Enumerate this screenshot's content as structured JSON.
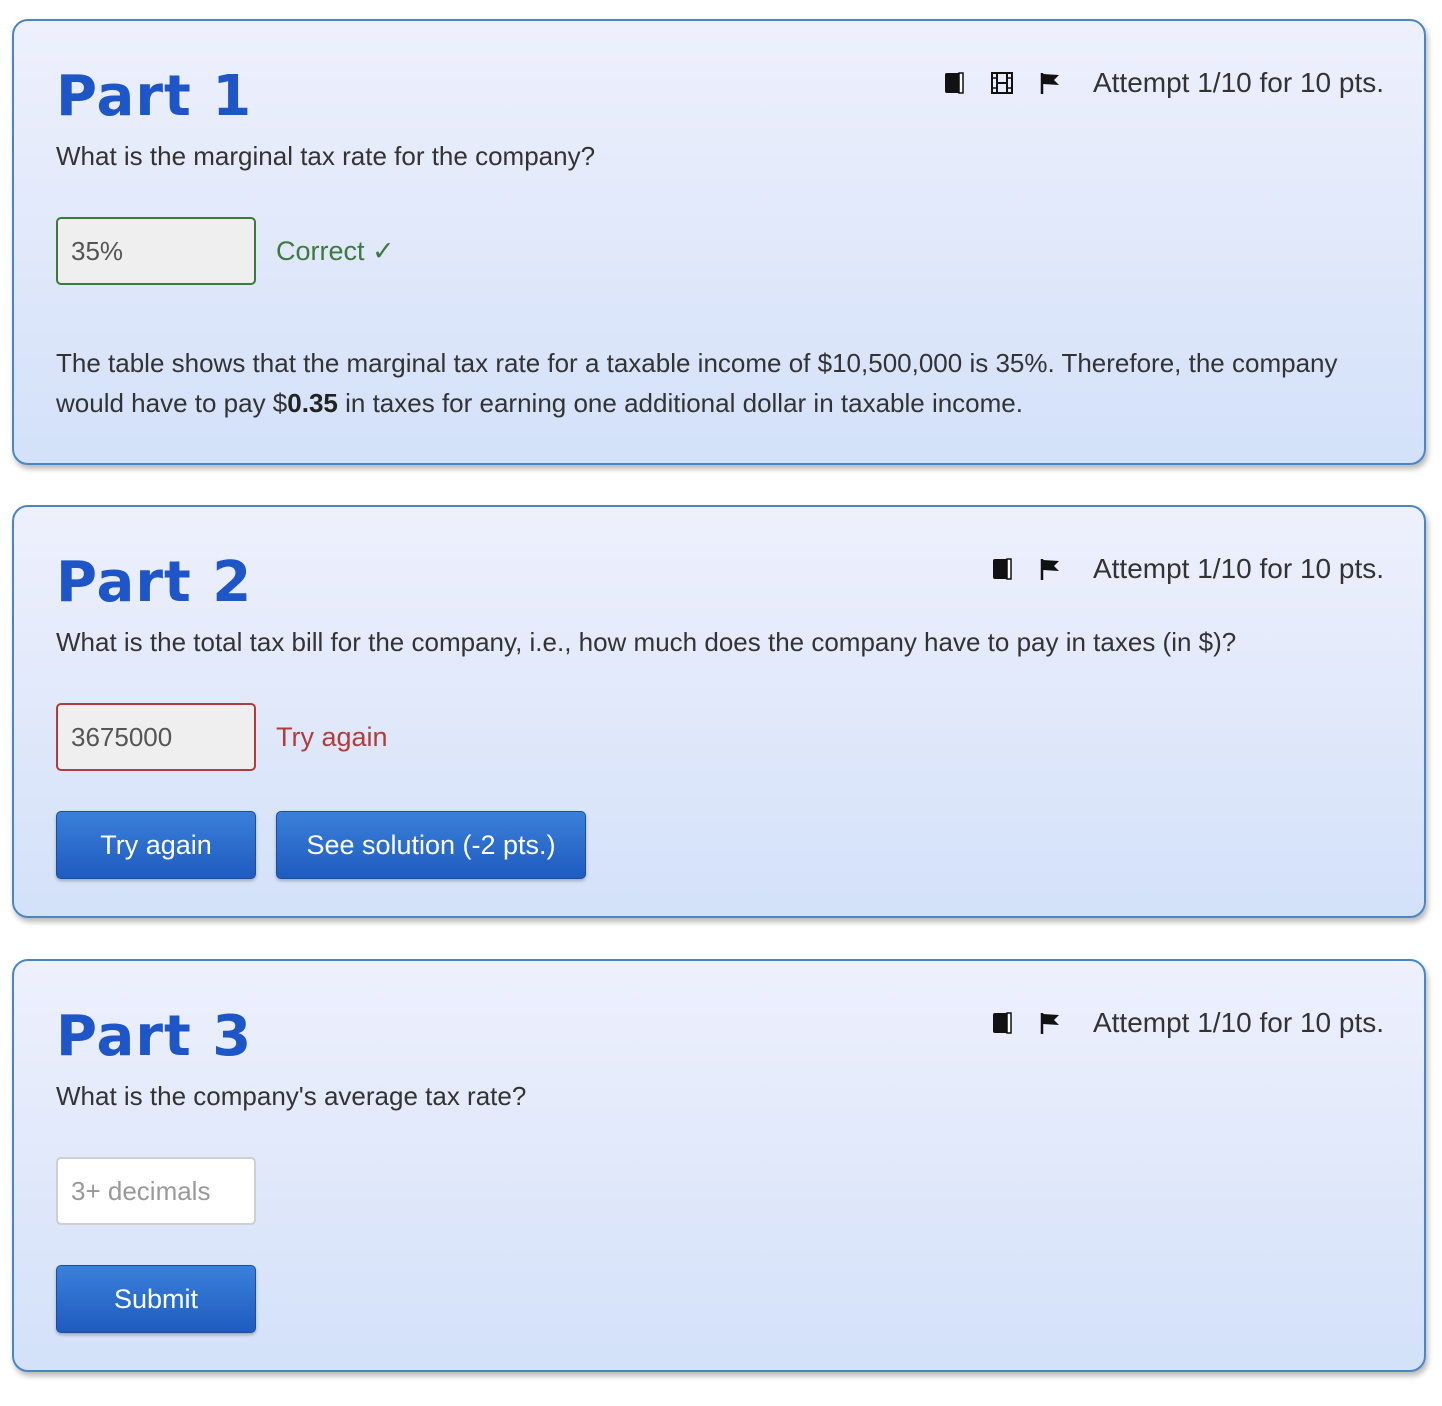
{
  "parts": [
    {
      "title": "Part 1",
      "attempt": "Attempt 1/10 for 10 pts.",
      "icons": [
        "book-icon",
        "film-icon",
        "flag-icon"
      ],
      "question": "What is the marginal tax rate for the company?",
      "answer_value": "35%",
      "feedback": "Correct ✓",
      "explanation": {
        "before": "The table shows that the marginal tax rate for a taxable income of $10,500,000 is 35%. Therefore, the company would have to pay $",
        "bold": "0.35",
        "after": " in taxes for earning one additional dollar in taxable income."
      }
    },
    {
      "title": "Part 2",
      "attempt": "Attempt 1/10 for 10 pts.",
      "icons": [
        "book-icon",
        "flag-icon"
      ],
      "question": "What is the total tax bill for the company, i.e., how much does the company have to pay in taxes (in $)?",
      "answer_value": "3675000",
      "feedback": "Try again",
      "buttons": [
        "Try again",
        "See solution (-2 pts.)"
      ]
    },
    {
      "title": "Part 3",
      "attempt": "Attempt 1/10 for 10 pts.",
      "icons": [
        "book-icon",
        "flag-icon"
      ],
      "question": "What is the company's average tax rate?",
      "answer_placeholder": "3+ decimals",
      "buttons": [
        "Submit"
      ]
    }
  ],
  "colors": {
    "title": "#1e55c7",
    "border": "#4a86c5",
    "correct": "#3d7a3d",
    "wrong": "#b23b3b",
    "button": "#2a6bcd"
  }
}
